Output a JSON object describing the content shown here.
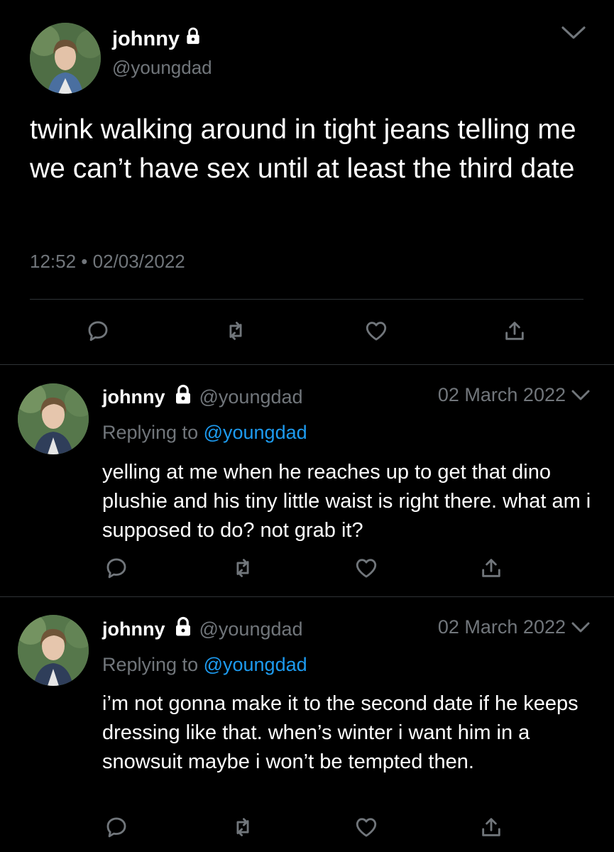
{
  "main_tweet": {
    "name": "johnny",
    "handle": "@youngdad",
    "text": "twink walking around in tight jeans telling me we can’t have sex until at least the third date",
    "timestamp": "12:52 • 02/03/2022",
    "icons": [
      "lock-icon",
      "chevron-down-icon",
      "reply-icon",
      "retweet-icon",
      "like-icon",
      "share-icon"
    ]
  },
  "replies": [
    {
      "name": "johnny",
      "handle": "@youngdad",
      "date": "02 March 2022",
      "replying_prefix": "Replying to ",
      "replying_to": "@youngdad",
      "text": "yelling at me when he reaches up to get that dino plushie and his tiny little waist is right there. what am i supposed to do? not grab it?"
    },
    {
      "name": "johnny",
      "handle": "@youngdad",
      "date": "02 March 2022",
      "replying_prefix": "Replying to ",
      "replying_to": "@youngdad",
      "text": "i’m not gonna make it to the second date if he keeps dressing like that. when’s winter i want him in a snowsuit maybe i won’t be tempted then."
    }
  ],
  "colors": {
    "background": "#000000",
    "text": "#ffffff",
    "muted": "#71767b",
    "link": "#1d9bf0",
    "divider": "#2f3336"
  }
}
